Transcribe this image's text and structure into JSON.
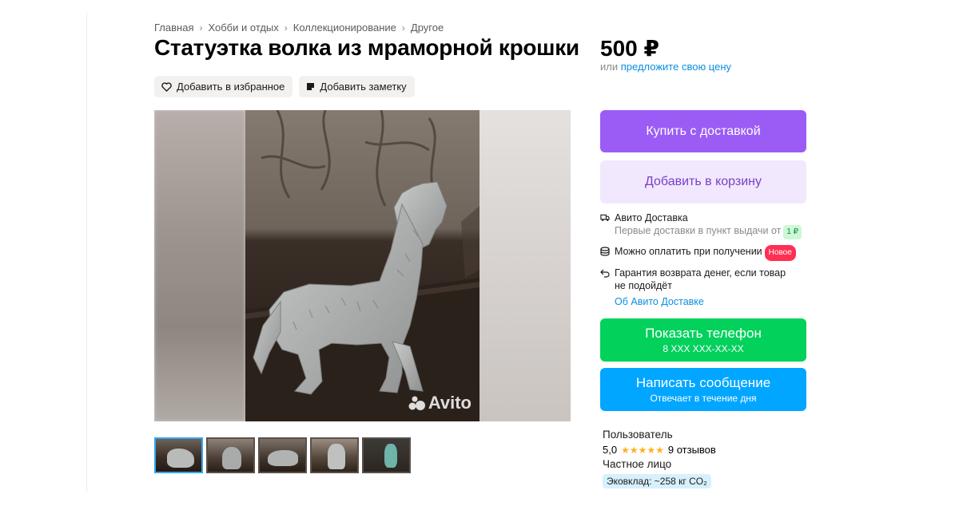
{
  "breadcrumb": [
    "Главная",
    "Хобби и отдых",
    "Коллекционирование",
    "Другое"
  ],
  "title": "Статуэтка волка из мраморной крошки",
  "actions": {
    "favorite_label": "Добавить в избранное",
    "note_label": "Добавить заметку"
  },
  "gallery": {
    "watermark": "Avito",
    "thumbnails_count": 5,
    "active_index": 0
  },
  "price": {
    "value": "500 ₽",
    "note_prefix": "или",
    "note_link": "предложите свою цену"
  },
  "buttons": {
    "buy": "Купить с доставкой",
    "cart": "Добавить в корзину",
    "phone_main": "Показать телефон",
    "phone_sub": "8 XXX XXX-XX-XX",
    "message_main": "Написать сообщение",
    "message_sub": "Отвечает в течение дня"
  },
  "delivery": {
    "title": "Авито Доставка",
    "subtitle": "Первые доставки в пункт выдачи от",
    "subtitle_badge": "1 ₽",
    "pay_on_receipt": "Можно оплатить при получении",
    "pay_badge": "Новое",
    "guarantee_line1": "Гарантия возврата денег, если товар",
    "guarantee_line2": "не подойдёт",
    "about_link": "Об Авито Доставке"
  },
  "seller": {
    "name": "Пользователь",
    "rating": "5,0",
    "stars": "★★★★★",
    "reviews": "9 отзывов",
    "kind": "Частное лицо",
    "eco": "Эковклад: ~258 кг CO₂"
  },
  "colors": {
    "buy": "#9b5cf6",
    "cart_bg": "#f1e8fd",
    "phone": "#02d15c",
    "message": "#00a6ff",
    "link": "#0a8fe0",
    "new_badge": "#ff2f53"
  }
}
